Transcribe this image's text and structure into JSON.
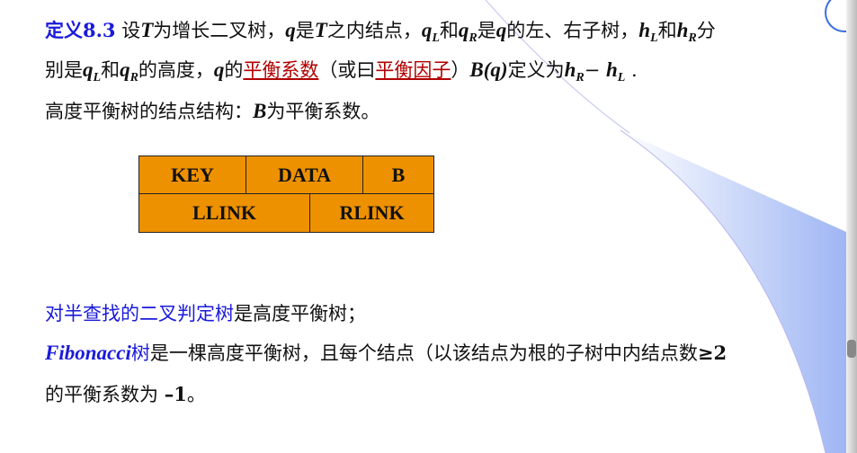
{
  "lines": [
    [
      {
        "t": "定义8.3",
        "c": "blue bold"
      },
      {
        "t": "  设"
      },
      {
        "t": "T",
        "c": "ital"
      },
      {
        "t": "为增长二叉树，"
      },
      {
        "t": "q",
        "c": "ital"
      },
      {
        "t": "是"
      },
      {
        "t": "T",
        "c": "ital"
      },
      {
        "t": "之内结点，"
      },
      {
        "t": "q",
        "c": "ital",
        "sub": "L"
      },
      {
        "t": "和"
      },
      {
        "t": "q",
        "c": "ital",
        "sub": "R"
      },
      {
        "t": "是"
      },
      {
        "t": "q",
        "c": "ital"
      },
      {
        "t": "的左、右子树，"
      },
      {
        "t": "h",
        "c": "ital",
        "sub": "L"
      },
      {
        "t": "和"
      },
      {
        "t": "h",
        "c": "ital",
        "sub": "R"
      },
      {
        "t": "分"
      }
    ],
    [
      {
        "t": "别是"
      },
      {
        "t": "q",
        "c": "ital",
        "sub": "L"
      },
      {
        "t": "和"
      },
      {
        "t": "q",
        "c": "ital",
        "sub": "R"
      },
      {
        "t": "的高度，"
      },
      {
        "t": "q",
        "c": "ital"
      },
      {
        "t": "的"
      },
      {
        "t": "平衡系数",
        "c": "red"
      },
      {
        "t": "（或曰"
      },
      {
        "t": "平衡因子",
        "c": "red"
      },
      {
        "t": "）"
      },
      {
        "t": "B(q)",
        "c": "ital"
      },
      {
        "t": "定义为"
      },
      {
        "t": "h",
        "c": "ital",
        "sub": "R"
      },
      {
        "t": "− "
      },
      {
        "t": "h",
        "c": "ital",
        "sub": "L"
      },
      {
        "t": " ."
      }
    ],
    [
      {
        "t": "高度平衡树的结点结构："
      },
      {
        "t": "B",
        "c": "ital"
      },
      {
        "t": "为平衡系数。"
      }
    ],
    [
      {
        "t": "对半查找的二叉判定树",
        "c": "blue"
      },
      {
        "t": "是高度平衡树；"
      }
    ],
    [
      {
        "t": "Fibonacci",
        "c": "blue ital"
      },
      {
        "t": "树",
        "c": "blue"
      },
      {
        "t": "是一棵高度平衡树，且每个结点（以该结点为根的子树中内结点数"
      },
      {
        "t": "≥2",
        "c": "bold"
      }
    ],
    [
      {
        "t": "的平衡系数为 "
      },
      {
        "t": "–1",
        "c": "bold"
      },
      {
        "t": "。"
      }
    ]
  ],
  "node_structure": {
    "key": "KEY",
    "data": "DATA",
    "b": "B",
    "llink": "LLINK",
    "rlink": "RLINK"
  },
  "colors": {
    "accent": "#1a1adb",
    "table_fill": "#ee9100",
    "link": "#b00000"
  }
}
